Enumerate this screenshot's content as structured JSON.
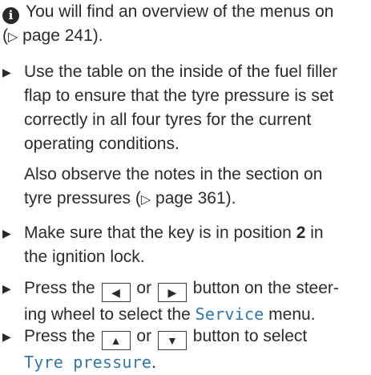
{
  "info": {
    "text_before": "You will find an overview of the menus on",
    "ref_open": "(",
    "ref_arrow": "▷",
    "ref_text": "page 241",
    "ref_close": ")."
  },
  "step1": {
    "line1": "Use the table on the inside of the fuel filler",
    "line2": "flap to ensure that the tyre pressure is set",
    "line3": "correctly in all four tyres for the current",
    "line4": "operating conditions."
  },
  "note": {
    "line1": "Also observe the notes in the section on",
    "line2_before": "tyre pressures (",
    "ref_arrow": "▷",
    "ref_text": "page 361",
    "ref_close": ")."
  },
  "step2": {
    "before": "Make sure that the key is in position",
    "key_position": "2",
    "after_line1": "in",
    "line2": "the ignition lock."
  },
  "step3": {
    "press": "Press the",
    "left_key": "◀",
    "or": "or",
    "right_key": "▶",
    "after": "button on the steer-",
    "line2_before": "ing wheel to select the",
    "menu_name": "Service",
    "line2_after": "menu."
  },
  "step4": {
    "press": "Press the",
    "up_key": "▲",
    "or": "or",
    "down_key": "▼",
    "after": "button to select",
    "menu_item": "Tyre pressure",
    "end": "."
  },
  "bullet_symbol": "▶"
}
